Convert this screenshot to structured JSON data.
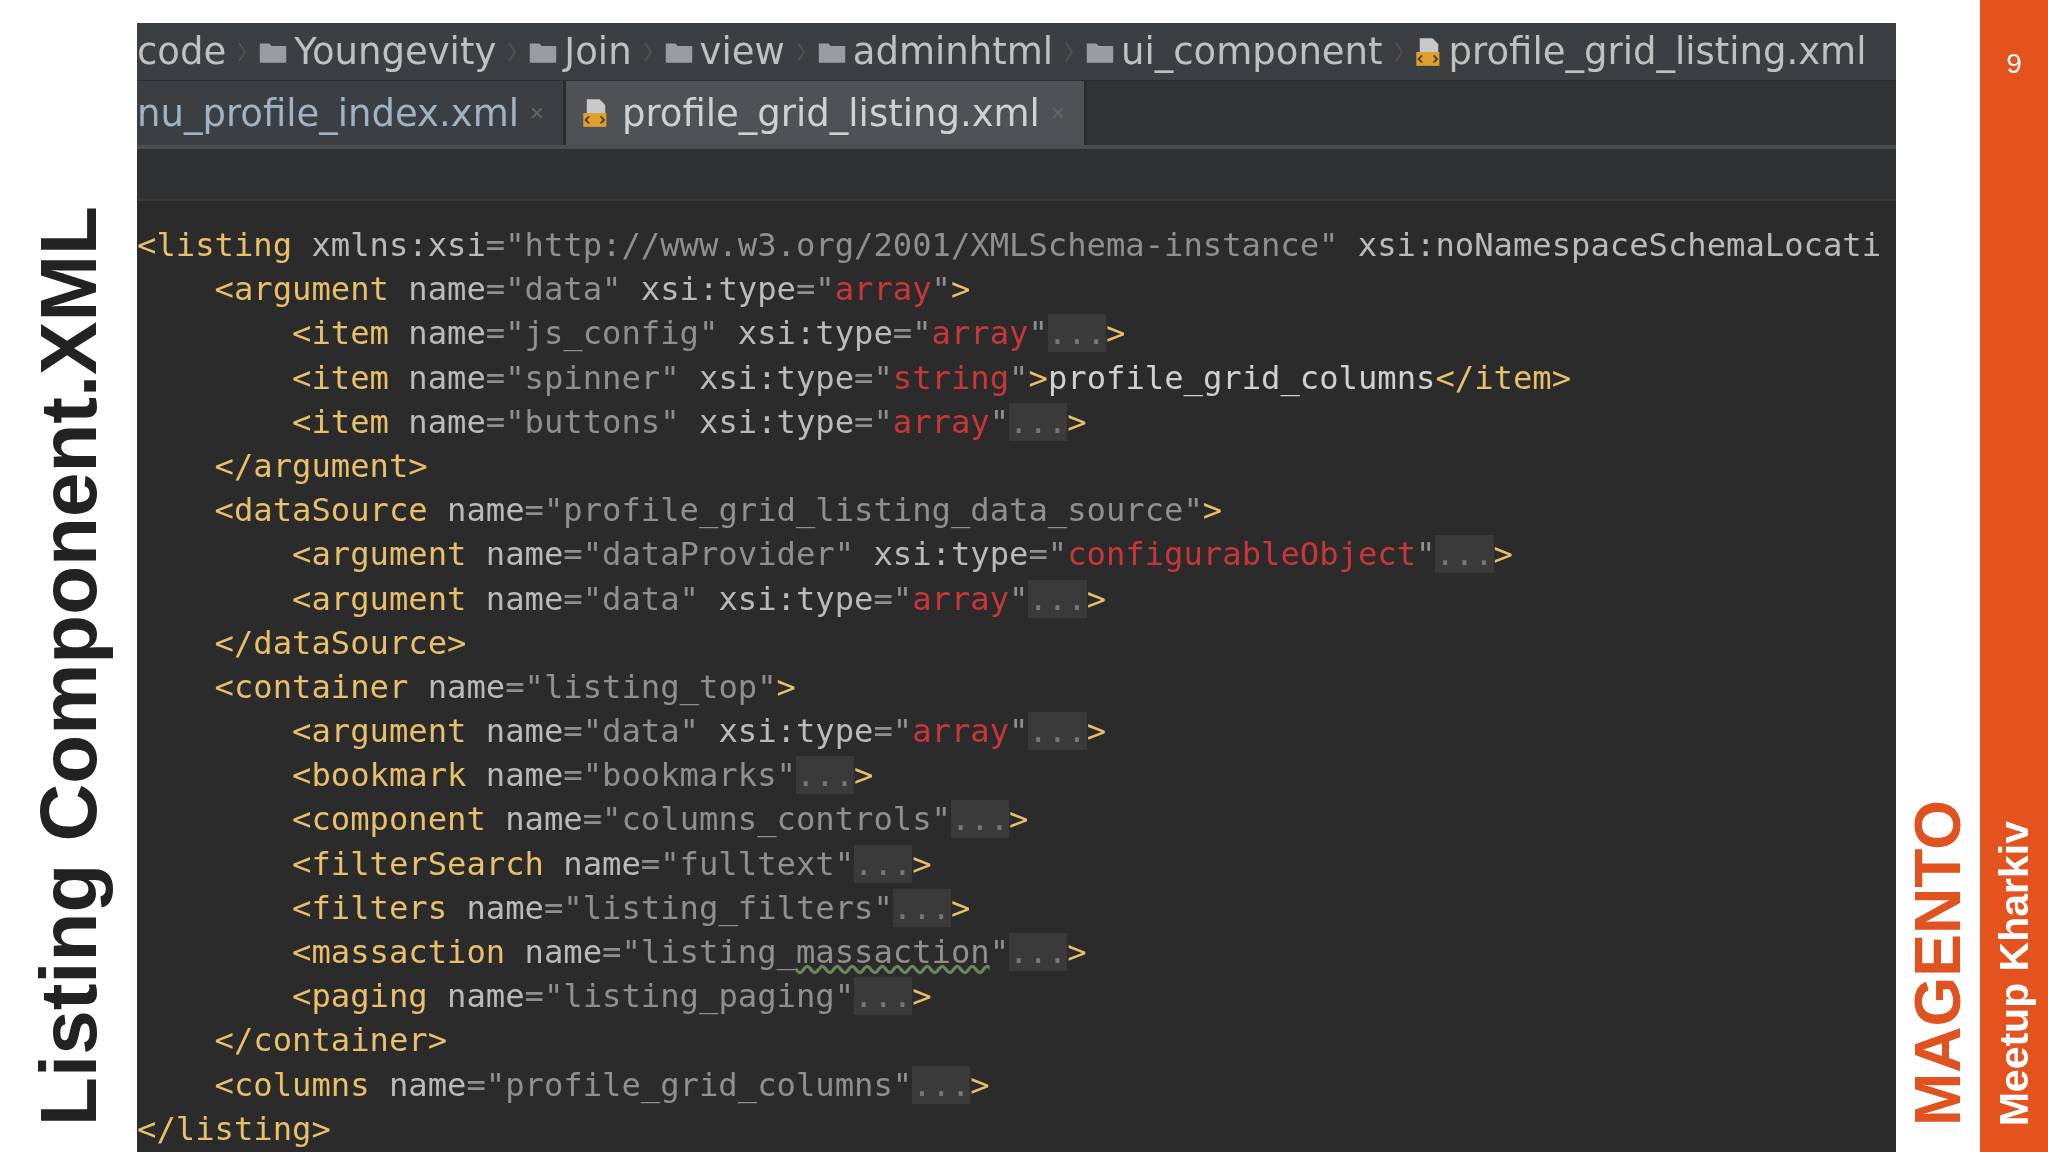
{
  "slide_title": "Listing Component.XML",
  "page_number": "9",
  "brand": {
    "logo": "MAGENTO",
    "subtitle": "Meetup Kharkiv"
  },
  "breadcrumbs": [
    {
      "label": "code",
      "kind": "plain"
    },
    {
      "label": "Youngevity",
      "kind": "folder"
    },
    {
      "label": "Join",
      "kind": "folder"
    },
    {
      "label": "view",
      "kind": "folder"
    },
    {
      "label": "adminhtml",
      "kind": "folder"
    },
    {
      "label": "ui_component",
      "kind": "folder"
    },
    {
      "label": "profile_grid_listing.xml",
      "kind": "file"
    }
  ],
  "tabs": [
    {
      "label": "nu_profile_index.xml",
      "kind": "plain",
      "selected": false
    },
    {
      "label": "profile_grid_listing.xml",
      "kind": "file",
      "selected": true
    }
  ],
  "code_lines": [
    [
      {
        "kind": "tag",
        "text": "<listing"
      },
      {
        "kind": "attr",
        "text": " xmlns:xsi"
      },
      {
        "kind": "str",
        "text": "=\"http://www.w3.org/2001/XMLSchema-instance\""
      },
      {
        "kind": "attr",
        "text": " xsi:noNamespaceSchemaLocati"
      }
    ],
    [
      {
        "kind": "tag",
        "text": "    <argument"
      },
      {
        "kind": "attr",
        "text": " name"
      },
      {
        "kind": "str",
        "text": "=\"data\""
      },
      {
        "kind": "attr",
        "text": " xsi:type"
      },
      {
        "kind": "str",
        "text": "=\""
      },
      {
        "kind": "type",
        "text": "array"
      },
      {
        "kind": "str",
        "text": "\""
      },
      {
        "kind": "tag",
        "text": ">"
      }
    ],
    [
      {
        "kind": "tag",
        "text": "        <item"
      },
      {
        "kind": "attr",
        "text": " name"
      },
      {
        "kind": "str",
        "text": "=\"js_config\""
      },
      {
        "kind": "attr",
        "text": " xsi:type"
      },
      {
        "kind": "str",
        "text": "=\""
      },
      {
        "kind": "type",
        "text": "array"
      },
      {
        "kind": "str",
        "text": "\""
      },
      {
        "kind": "fold",
        "text": "..."
      },
      {
        "kind": "tag",
        "text": ">"
      }
    ],
    [
      {
        "kind": "tag",
        "text": "        <item"
      },
      {
        "kind": "attr",
        "text": " name"
      },
      {
        "kind": "str",
        "text": "=\"spinner\""
      },
      {
        "kind": "attr",
        "text": " xsi:type"
      },
      {
        "kind": "str",
        "text": "=\""
      },
      {
        "kind": "type",
        "text": "string"
      },
      {
        "kind": "str",
        "text": "\""
      },
      {
        "kind": "tag",
        "text": ">"
      },
      {
        "kind": "text",
        "text": "profile_grid_columns"
      },
      {
        "kind": "tag",
        "text": "</item>"
      }
    ],
    [
      {
        "kind": "tag",
        "text": "        <item"
      },
      {
        "kind": "attr",
        "text": " name"
      },
      {
        "kind": "str",
        "text": "=\"buttons\""
      },
      {
        "kind": "attr",
        "text": " xsi:type"
      },
      {
        "kind": "str",
        "text": "=\""
      },
      {
        "kind": "type",
        "text": "array"
      },
      {
        "kind": "str",
        "text": "\""
      },
      {
        "kind": "fold",
        "text": "..."
      },
      {
        "kind": "tag",
        "text": ">"
      }
    ],
    [
      {
        "kind": "tag",
        "text": "    </argument>"
      }
    ],
    [
      {
        "kind": "tag",
        "text": "    <dataSource"
      },
      {
        "kind": "attr",
        "text": " name"
      },
      {
        "kind": "str",
        "text": "=\"profile_grid_listing_data_source\""
      },
      {
        "kind": "tag",
        "text": ">"
      }
    ],
    [
      {
        "kind": "tag",
        "text": "        <argument"
      },
      {
        "kind": "attr",
        "text": " name"
      },
      {
        "kind": "str",
        "text": "=\"dataProvider\""
      },
      {
        "kind": "attr",
        "text": " xsi:type"
      },
      {
        "kind": "str",
        "text": "=\""
      },
      {
        "kind": "type",
        "text": "configurableObject"
      },
      {
        "kind": "str",
        "text": "\""
      },
      {
        "kind": "fold",
        "text": "..."
      },
      {
        "kind": "tag",
        "text": ">"
      }
    ],
    [
      {
        "kind": "tag",
        "text": "        <argument"
      },
      {
        "kind": "attr",
        "text": " name"
      },
      {
        "kind": "str",
        "text": "=\"data\""
      },
      {
        "kind": "attr",
        "text": " xsi:type"
      },
      {
        "kind": "str",
        "text": "=\""
      },
      {
        "kind": "type",
        "text": "array"
      },
      {
        "kind": "str",
        "text": "\""
      },
      {
        "kind": "fold",
        "text": "..."
      },
      {
        "kind": "tag",
        "text": ">"
      }
    ],
    [
      {
        "kind": "tag",
        "text": "    </dataSource>"
      }
    ],
    [
      {
        "kind": "tag",
        "text": "    <container"
      },
      {
        "kind": "attr",
        "text": " name"
      },
      {
        "kind": "str",
        "text": "=\"listing_top\""
      },
      {
        "kind": "tag",
        "text": ">"
      }
    ],
    [
      {
        "kind": "tag",
        "text": "        <argument"
      },
      {
        "kind": "attr",
        "text": " name"
      },
      {
        "kind": "str",
        "text": "=\"data\""
      },
      {
        "kind": "attr",
        "text": " xsi:type"
      },
      {
        "kind": "str",
        "text": "=\""
      },
      {
        "kind": "type",
        "text": "array"
      },
      {
        "kind": "str",
        "text": "\""
      },
      {
        "kind": "fold",
        "text": "..."
      },
      {
        "kind": "tag",
        "text": ">"
      }
    ],
    [
      {
        "kind": "tag",
        "text": "        <bookmark"
      },
      {
        "kind": "attr",
        "text": " name"
      },
      {
        "kind": "str",
        "text": "=\"bookmarks\""
      },
      {
        "kind": "fold",
        "text": "..."
      },
      {
        "kind": "tag",
        "text": ">"
      }
    ],
    [
      {
        "kind": "tag",
        "text": "        <component"
      },
      {
        "kind": "attr",
        "text": " name"
      },
      {
        "kind": "str",
        "text": "=\"columns_controls\""
      },
      {
        "kind": "fold",
        "text": "..."
      },
      {
        "kind": "tag",
        "text": ">"
      }
    ],
    [
      {
        "kind": "tag",
        "text": "        <filterSearch"
      },
      {
        "kind": "attr",
        "text": " name"
      },
      {
        "kind": "str",
        "text": "=\"fulltext\""
      },
      {
        "kind": "fold",
        "text": "..."
      },
      {
        "kind": "tag",
        "text": ">"
      }
    ],
    [
      {
        "kind": "tag",
        "text": "        <filters"
      },
      {
        "kind": "attr",
        "text": " name"
      },
      {
        "kind": "str",
        "text": "=\"listing_filters\""
      },
      {
        "kind": "fold",
        "text": "..."
      },
      {
        "kind": "tag",
        "text": ">"
      }
    ],
    [
      {
        "kind": "tag",
        "text": "        <massaction"
      },
      {
        "kind": "attr",
        "text": " name"
      },
      {
        "kind": "str",
        "text": "=\"listing_"
      },
      {
        "kind": "typo",
        "text": "massaction"
      },
      {
        "kind": "str",
        "text": "\""
      },
      {
        "kind": "fold",
        "text": "..."
      },
      {
        "kind": "tag",
        "text": ">"
      }
    ],
    [
      {
        "kind": "tag",
        "text": "        <paging"
      },
      {
        "kind": "attr",
        "text": " name"
      },
      {
        "kind": "str",
        "text": "=\"listing_paging\""
      },
      {
        "kind": "fold",
        "text": "..."
      },
      {
        "kind": "tag",
        "text": ">"
      }
    ],
    [
      {
        "kind": "tag",
        "text": "    </container>"
      }
    ],
    [
      {
        "kind": "tag",
        "text": "    <columns"
      },
      {
        "kind": "attr",
        "text": " name"
      },
      {
        "kind": "str",
        "text": "=\"profile_grid_columns\""
      },
      {
        "kind": "fold",
        "text": "..."
      },
      {
        "kind": "tag",
        "text": ">"
      }
    ],
    [
      {
        "kind": "tag",
        "text": "</listing>"
      }
    ]
  ]
}
